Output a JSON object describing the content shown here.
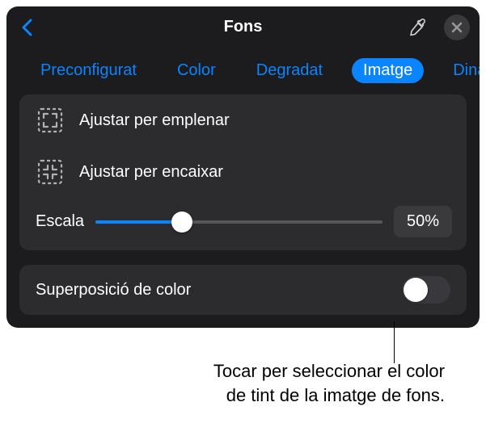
{
  "header": {
    "title": "Fons"
  },
  "tabs": [
    {
      "label": "Preconfigurat",
      "active": false
    },
    {
      "label": "Color",
      "active": false
    },
    {
      "label": "Degradat",
      "active": false
    },
    {
      "label": "Imatge",
      "active": true
    },
    {
      "label": "Dinàmic",
      "active": false
    }
  ],
  "fitOptions": {
    "fill": "Ajustar per emplenar",
    "fit": "Ajustar per encaixar"
  },
  "scale": {
    "label": "Escala",
    "value": 50,
    "display": "50%"
  },
  "overlay": {
    "label": "Superposició de color",
    "on": false
  },
  "callout": {
    "line1": "Tocar per seleccionar el color",
    "line2": "de tint de la imatge de fons."
  }
}
